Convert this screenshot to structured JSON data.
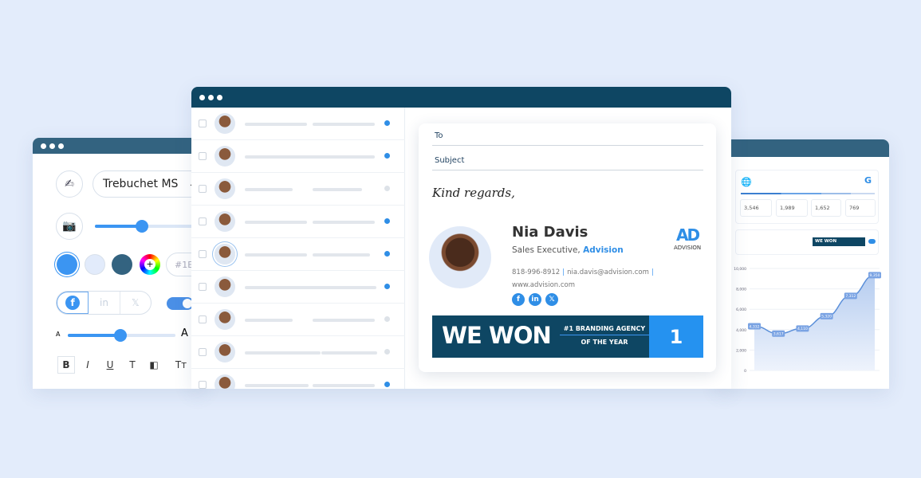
{
  "editor": {
    "font_select": "Trebuchet MS",
    "hex_input": "#1E",
    "swatches": [
      "#3b95f2",
      "#e2ebfb",
      "#336380"
    ],
    "photo_size_percent": 48,
    "font_size_percent": 48,
    "size_small_label": "A",
    "size_large_label": "A",
    "social_options": [
      "f",
      "in",
      "𝕏"
    ],
    "format_buttons": [
      "B",
      "I",
      "U",
      "T",
      "◧",
      "Tт"
    ]
  },
  "inbox": {
    "rows": [
      {
        "unread": true
      },
      {
        "unread": true
      },
      {
        "unread": false
      },
      {
        "unread": true
      },
      {
        "unread": true
      },
      {
        "unread": true
      },
      {
        "unread": false
      },
      {
        "unread": false
      },
      {
        "unread": true
      }
    ]
  },
  "compose": {
    "to_label": "To",
    "subject_label": "Subject",
    "signoff": "Kind regards,",
    "name": "Nia Davis",
    "job_title": "Sales Executive,",
    "company": "Advision",
    "phone": "818-996-8912",
    "email": "nia.davis@advision.com",
    "website": "www.advision.com",
    "logo_text": "ADVISION",
    "banner": {
      "headline": "WE WON",
      "line1": "#1 BRANDING AGENCY",
      "line2": "OF THE YEAR",
      "badge": "1"
    }
  },
  "analytics": {
    "stats": [
      "3,546",
      "1,989",
      "1,652",
      "769"
    ],
    "mini_banner": "WE WON"
  },
  "chart_data": {
    "type": "area",
    "yticks": [
      "10,000",
      "8,000",
      "6,000",
      "4,000",
      "2,000",
      "0"
    ],
    "ylim": [
      0,
      10000
    ],
    "values": [
      4332,
      3617,
      4110,
      5320,
      7312,
      9350
    ],
    "labels": [
      "4,332",
      "3,617",
      "4,110",
      "5,320",
      "7,312",
      "9,350"
    ],
    "color": "#5b8fd9"
  }
}
